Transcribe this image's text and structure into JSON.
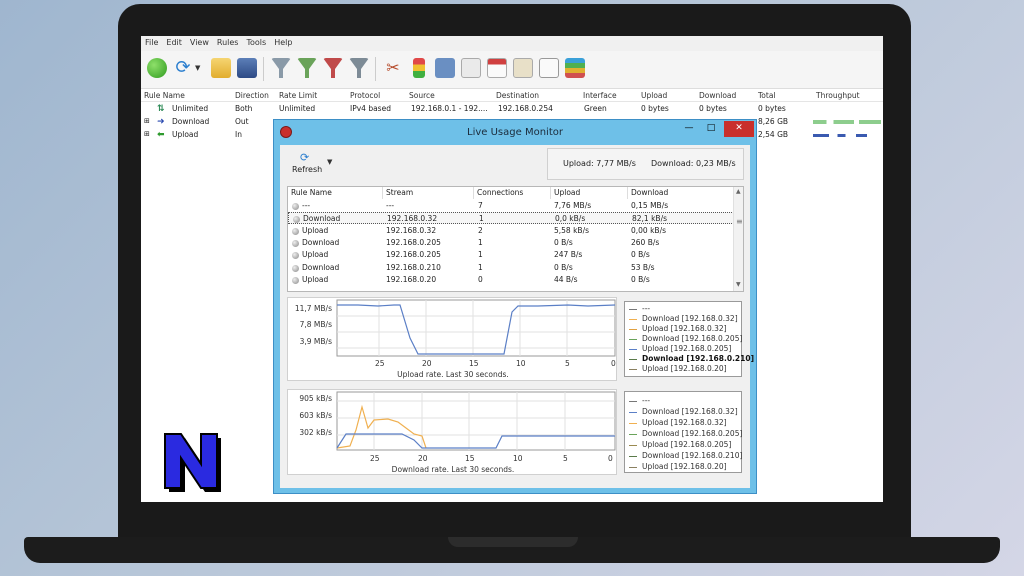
{
  "menu": [
    "File",
    "Edit",
    "View",
    "Rules",
    "Tools",
    "Help"
  ],
  "main_table": {
    "headers": [
      "Rule Name",
      "Direction",
      "Rate Limit",
      "Protocol",
      "Source",
      "Destination",
      "Interface",
      "Upload",
      "Download",
      "Total",
      "Throughput"
    ],
    "rows": [
      {
        "name": "Unlimited",
        "direction": "Both",
        "rate": "Unlimited",
        "protocol": "IPv4 based",
        "source": "192.168.0.1 - 192....",
        "destination": "192.168.0.254",
        "interface": "Green",
        "upload": "0 bytes",
        "download": "0 bytes",
        "total": "0 bytes"
      },
      {
        "name": "Download",
        "direction": "Out",
        "total": "8,26 GB"
      },
      {
        "name": "Upload",
        "direction": "In",
        "total": "2,54 GB"
      }
    ]
  },
  "dialog": {
    "title": "Live Usage Monitor",
    "refresh_label": "Refresh",
    "upload_rate": "Upload: 7,77 MB/s",
    "download_rate": "Download: 0,23 MB/s",
    "buttons": {
      "minimize": "—",
      "maximize": "□",
      "close": "✕"
    }
  },
  "streams": {
    "headers": [
      "Rule Name",
      "Stream",
      "Connections",
      "Upload",
      "Download"
    ],
    "rows": [
      {
        "rule": "---",
        "stream": "---",
        "connections": "7",
        "upload": "7,76 MB/s",
        "download": "0,15 MB/s"
      },
      {
        "rule": "Download",
        "stream": "192.168.0.32",
        "connections": "1",
        "upload": "0,0 kB/s",
        "download": "82,1 kB/s"
      },
      {
        "rule": "Upload",
        "stream": "192.168.0.32",
        "connections": "2",
        "upload": "5,58 kB/s",
        "download": "0,00 kB/s"
      },
      {
        "rule": "Download",
        "stream": "192.168.0.205",
        "connections": "1",
        "upload": "0 B/s",
        "download": "260 B/s"
      },
      {
        "rule": "Upload",
        "stream": "192.168.0.205",
        "connections": "1",
        "upload": "247 B/s",
        "download": "0 B/s"
      },
      {
        "rule": "Download",
        "stream": "192.168.0.210",
        "connections": "1",
        "upload": "0 B/s",
        "download": "53 B/s"
      },
      {
        "rule": "Upload",
        "stream": "192.168.0.20",
        "connections": "0",
        "upload": "44 B/s",
        "download": "0 B/s"
      }
    ]
  },
  "upload_graph": {
    "caption": "Upload rate. Last 30 seconds.",
    "y_ticks": [
      "11,7 MB/s",
      "7,8 MB/s",
      "3,9 MB/s"
    ],
    "x_ticks": [
      "25",
      "20",
      "15",
      "10",
      "5",
      "0"
    ],
    "legend": [
      "---",
      "Download [192.168.0.32]",
      "Upload [192.168.0.32]",
      "Download [192.168.0.205]",
      "Upload [192.168.0.205]",
      "Download [192.168.0.210]",
      "Upload [192.168.0.20]"
    ]
  },
  "download_graph": {
    "caption": "Download rate. Last 30 seconds.",
    "y_ticks": [
      "905 kB/s",
      "603 kB/s",
      "302 kB/s"
    ],
    "x_ticks": [
      "25",
      "20",
      "15",
      "10",
      "5",
      "0"
    ],
    "legend": [
      "---",
      "Download [192.168.0.32]",
      "Upload [192.168.0.32]",
      "Download [192.168.0.205]",
      "Upload [192.168.0.205]",
      "Download [192.168.0.210]",
      "Upload [192.168.0.20]"
    ]
  },
  "colors": {
    "dialog_frame": "#6ec0e8",
    "close_button": "#c9302c",
    "blue_series": "#5b7fc6",
    "orange_series": "#f0b050",
    "logo_fill": "#2a2ae0"
  }
}
